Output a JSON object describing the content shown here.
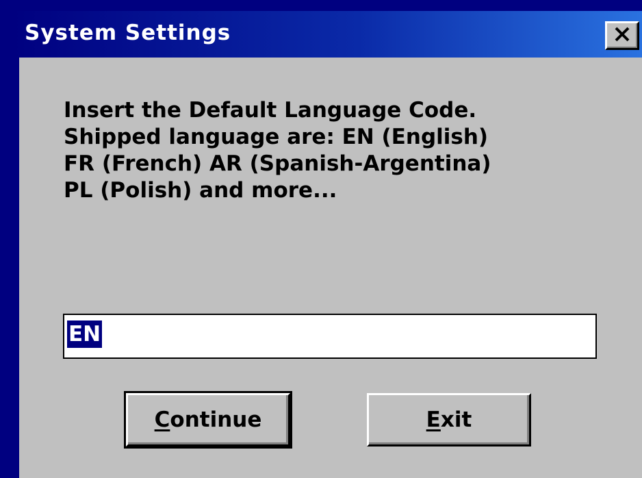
{
  "window": {
    "title": "System Settings",
    "close_icon": "close-icon"
  },
  "dialog": {
    "message_lines": [
      "Insert the Default Language Code.",
      "Shipped language are: EN (English)",
      "FR (French) AR (Spanish-Argentina)",
      "PL (Polish) and more..."
    ],
    "language_code_value": "EN",
    "continue_button": {
      "mnemonic": "C",
      "rest": "ontinue"
    },
    "exit_button": {
      "mnemonic": "E",
      "rest": "xit"
    }
  },
  "colors": {
    "title_bar_start": "#000080",
    "title_bar_end": "#2a72e0",
    "face": "#c0c0c0",
    "selection": "#000080"
  }
}
